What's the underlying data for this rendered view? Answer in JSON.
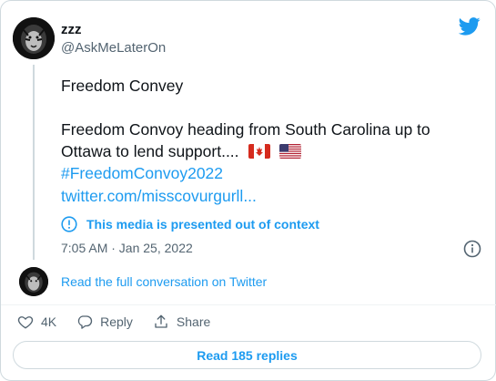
{
  "author": {
    "name": "zzz",
    "handle": "@AskMeLaterOn"
  },
  "tweet": {
    "line1": "Freedom Convey",
    "line2": "Freedom Convoy heading from South Carolina up to",
    "line3": "Ottawa to lend support....",
    "hashtag": "#FreedomConvoy2022",
    "link": "twitter.com/misscovurgurll...",
    "flags": [
      "canada-flag-icon",
      "us-flag-icon"
    ]
  },
  "context_notice": "This media is presented out of context",
  "timestamp": "7:05 AM · Jan 25, 2022",
  "read_full": "Read the full conversation on Twitter",
  "actions": {
    "like_count": "4K",
    "reply_label": "Reply",
    "share_label": "Share"
  },
  "read_replies": "Read 185 replies",
  "colors": {
    "accent": "#1d9bf0",
    "text": "#0f1419",
    "muted": "#536471",
    "border": "#cfd9de"
  }
}
